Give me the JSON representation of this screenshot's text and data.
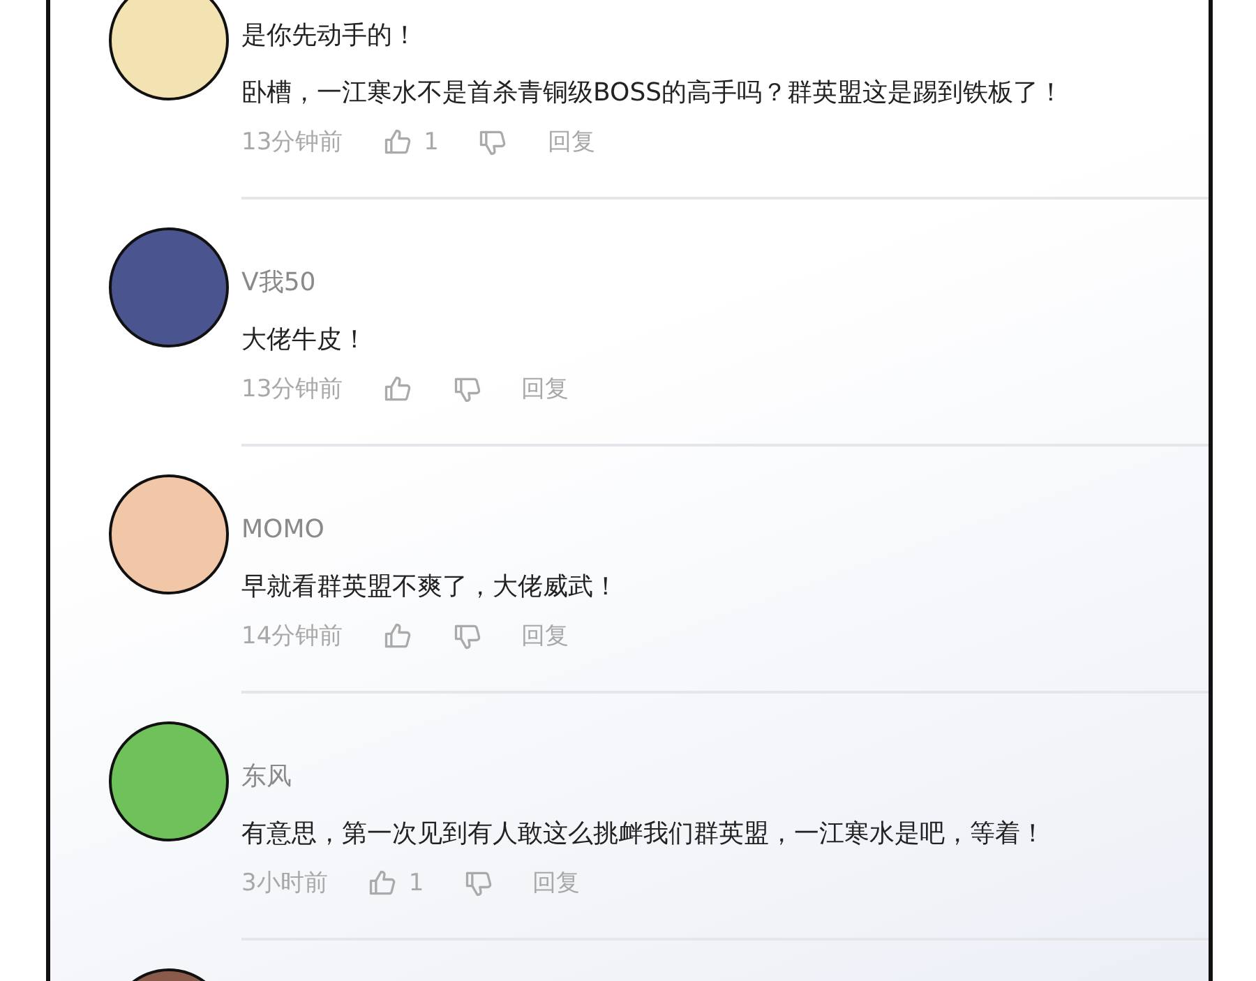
{
  "comments": [
    {
      "color": "#f3e3b3",
      "name": "是你先动手的！",
      "highlighted": true,
      "text": "卧槽，一江寒水不是首杀青铜级BOSS的高手吗？群英盟这是踢到铁板了！",
      "time": "13分钟前",
      "likes": "1",
      "reply": "回复"
    },
    {
      "color": "#4a5590",
      "name": "V我50",
      "highlighted": false,
      "text": "大佬牛皮！",
      "time": "13分钟前",
      "reply": "回复"
    },
    {
      "color": "#f2c7a8",
      "name": "MOMO",
      "highlighted": false,
      "text": "早就看群英盟不爽了，大佬威武！",
      "time": "14分钟前",
      "reply": "回复"
    },
    {
      "color": "#6fc25a",
      "name": "东风",
      "highlighted": false,
      "text": "有意思，第一次见到有人敢这么挑衅我们群英盟，一江寒水是吧，等着！",
      "time": "3小时前",
      "likes": "1",
      "reply": "回复"
    },
    {
      "color": "#8a5a4a"
    }
  ]
}
